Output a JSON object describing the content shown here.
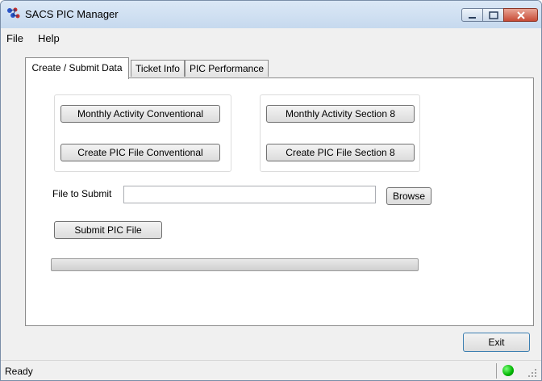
{
  "window": {
    "title": "SACS PIC Manager"
  },
  "menu": {
    "items": [
      {
        "label": "File"
      },
      {
        "label": "Help"
      }
    ]
  },
  "tabs": [
    {
      "label": "Create / Submit Data",
      "active": true
    },
    {
      "label": "Ticket Info",
      "active": false
    },
    {
      "label": "PIC Performance",
      "active": false
    }
  ],
  "conventional_group": {
    "monthly_activity_label": "Monthly Activity Conventional",
    "create_pic_label": "Create PIC File Conventional"
  },
  "section8_group": {
    "monthly_activity_label": "Monthly Activity Section 8",
    "create_pic_label": "Create PIC File Section 8"
  },
  "file_submit": {
    "label": "File to Submit",
    "value": "",
    "browse_label": "Browse",
    "submit_label": "Submit PIC File"
  },
  "progress": {
    "value_percent": 0
  },
  "footer": {
    "exit_label": "Exit"
  },
  "status": {
    "text": "Ready",
    "indicator_color": "#00b400"
  }
}
